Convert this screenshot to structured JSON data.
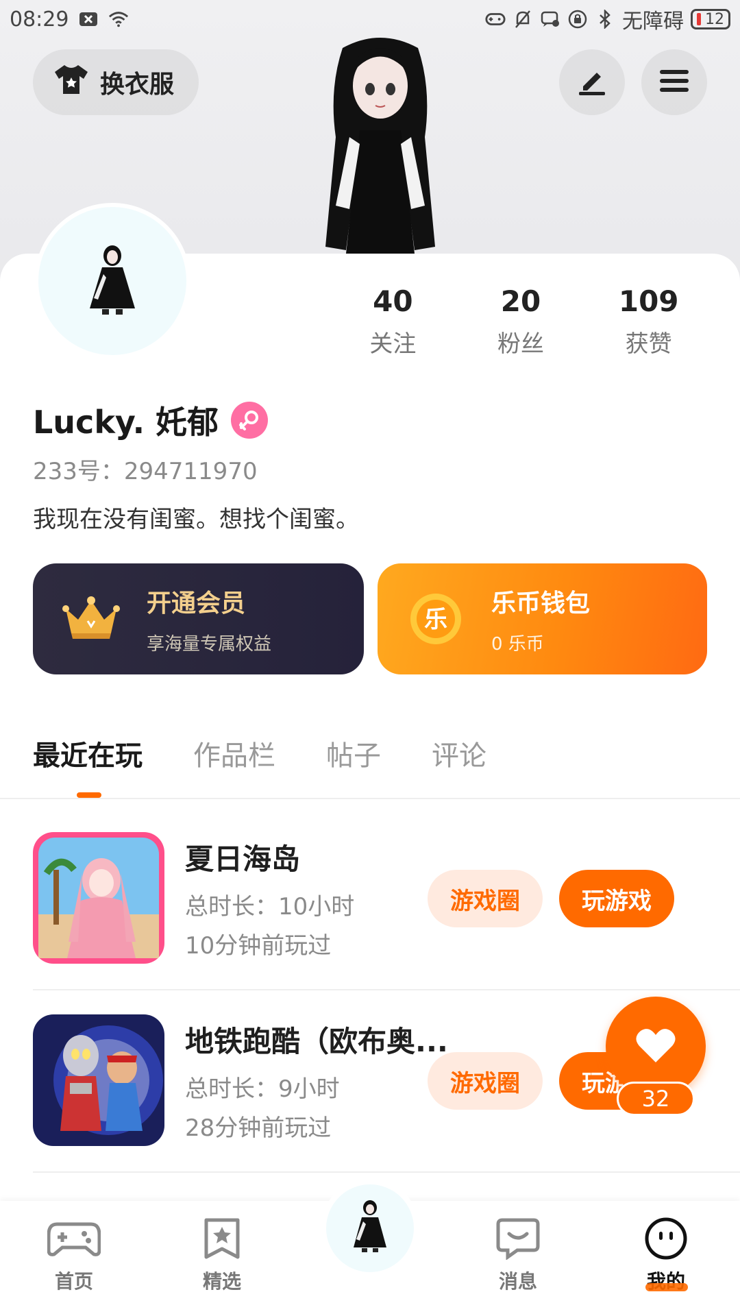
{
  "status_bar": {
    "time": "08:29",
    "accessibility": "无障碍",
    "battery": "12",
    "icons": [
      "close-box-icon",
      "wifi-icon",
      "gamepad-icon",
      "bell-off-icon",
      "chat-off-icon",
      "lock-rotation-icon",
      "bluetooth-icon"
    ]
  },
  "header": {
    "outfit_label": "换衣服",
    "edit_icon": "edit-icon",
    "menu_icon": "menu-icon"
  },
  "profile": {
    "name": "Lucky. 奼郁",
    "gender": "female",
    "uid": "233号：294711970",
    "bio": "我现在没有闺蜜。想找个闺蜜。",
    "stats": [
      {
        "value": "40",
        "label": "关注"
      },
      {
        "value": "20",
        "label": "粉丝"
      },
      {
        "value": "109",
        "label": "获赞"
      }
    ]
  },
  "promo": {
    "vip": {
      "title": "开通会员",
      "subtitle": "享海量专属权益",
      "icon": "crown-icon"
    },
    "wallet": {
      "title": "乐币钱包",
      "subtitle": "0 乐币",
      "icon": "coin-icon",
      "coin_char": "乐"
    }
  },
  "tabs": [
    {
      "label": "最近在玩",
      "active": true
    },
    {
      "label": "作品栏",
      "active": false
    },
    {
      "label": "帖子",
      "active": false
    },
    {
      "label": "评论",
      "active": false
    }
  ],
  "games": [
    {
      "title": "夏日海岛",
      "duration": "总时长：10小时",
      "last_played": "10分钟前玩过",
      "circle_label": "游戏圈",
      "play_label": "玩游戏"
    },
    {
      "title": "地铁跑酷（欧布奥...",
      "duration": "总时长：9小时",
      "last_played": "28分钟前玩过",
      "circle_label": "游戏圈",
      "play_label": "玩游戏"
    }
  ],
  "like_fab": {
    "count": "32"
  },
  "bottom_nav": [
    {
      "label": "首页",
      "icon": "gamepad-icon",
      "active": false
    },
    {
      "label": "精选",
      "icon": "star-bookmark-icon",
      "active": false
    },
    {
      "label": "",
      "icon": "avatar-center-icon",
      "active": false
    },
    {
      "label": "消息",
      "icon": "chat-smile-icon",
      "active": false
    },
    {
      "label": "我的",
      "icon": "face-icon",
      "active": true
    }
  ],
  "colors": {
    "accent": "#ff6a00",
    "vip_bg": "#2e2b3f",
    "wallet_bg": "#ff8a10",
    "gender": "#ff6ea3"
  }
}
